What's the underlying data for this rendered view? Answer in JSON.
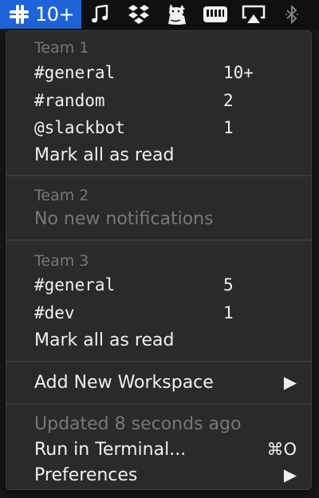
{
  "menubar": {
    "slack_count": "10+",
    "icons": [
      "slack-icon",
      "music-note-icon",
      "dropbox-icon",
      "cat-icon",
      "keyboard-icon",
      "airplay-icon",
      "bluetooth-icon"
    ]
  },
  "menu": {
    "team1": {
      "header": "Team 1",
      "channels": [
        {
          "name": "#general",
          "count": "10+"
        },
        {
          "name": "#random",
          "count": "2"
        },
        {
          "name": "@slackbot",
          "count": "1"
        }
      ],
      "mark_all": "Mark all as read"
    },
    "team2": {
      "header": "Team 2",
      "empty": "No new notifications"
    },
    "team3": {
      "header": "Team 3",
      "channels": [
        {
          "name": "#general",
          "count": "5"
        },
        {
          "name": "#dev",
          "count": "1"
        }
      ],
      "mark_all": "Mark all as read"
    },
    "add_workspace": "Add New Workspace",
    "updated": "Updated 8 seconds ago",
    "run_terminal": "Run in Terminal...",
    "run_shortcut": "⌘O",
    "preferences": "Preferences",
    "submenu_arrow": "▶"
  },
  "colors": {
    "accent": "#1e64d8",
    "menu_bg": "#2a2a2c",
    "text": "#f0f0f0",
    "muted": "#77777a"
  }
}
